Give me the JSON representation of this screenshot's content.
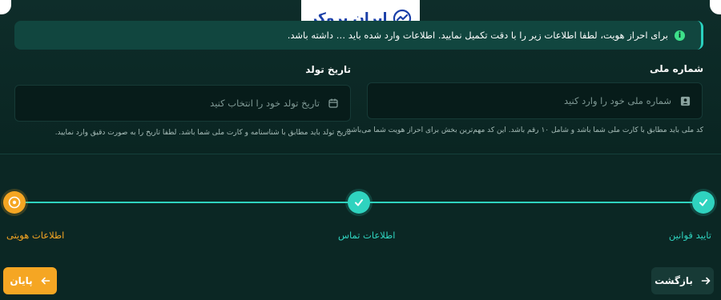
{
  "brand": {
    "name": "ایران بروکر",
    "logo_color": "#1a3fa8"
  },
  "banner": {
    "icon": "info-icon",
    "text": "برای احراز هویت، لطفا اطلاعات زیر را با دقت تکمیل نمایید. اطلاعات وارد شده باید … داشته باشد."
  },
  "form": {
    "national_id": {
      "label": "شماره ملی",
      "placeholder": "شماره ملی خود را وارد کنید",
      "icon": "id-card-icon",
      "hint": "کد ملی باید مطابق با کارت ملی شما باشد و شامل ۱۰ رقم باشد. این کد مهم‌ترین بخش برای احراز هویت شما می‌باشد."
    },
    "birth_date": {
      "label": "تاریخ تولد",
      "placeholder": "تاریخ تولد خود را انتخاب کنید",
      "icon": "calendar-icon",
      "hint": "تاریخ تولد باید مطابق با شناسنامه و کارت ملی شما باشد. لطفا تاریخ را به صورت دقیق وارد نمایید."
    }
  },
  "stepper": {
    "steps": [
      {
        "label": "تایید قوانین",
        "status": "done"
      },
      {
        "label": "اطلاعات تماس",
        "status": "done"
      },
      {
        "label": "اطلاعات هویتی",
        "status": "current"
      }
    ],
    "colors": {
      "done": "#2fd3bf",
      "current": "#f5a623"
    }
  },
  "actions": {
    "back_label": "بازگشت",
    "finish_label": "پایان"
  }
}
